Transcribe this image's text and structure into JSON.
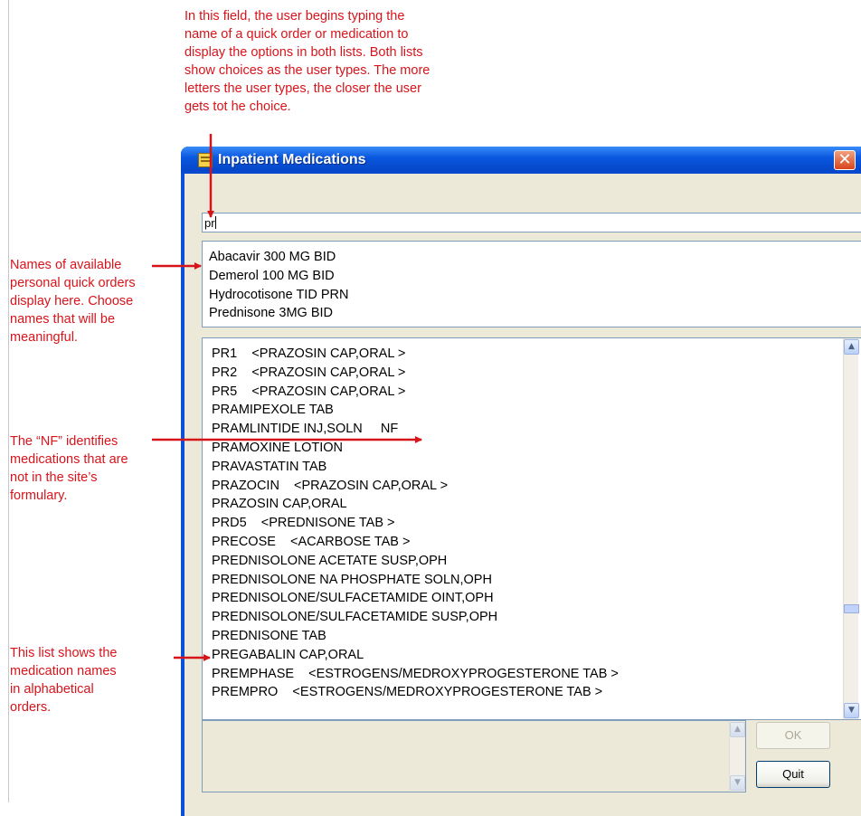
{
  "annotations": {
    "top": [
      "In this field, the user begins typing the",
      "name of a quick order or medication to",
      "display the options in both lists. Both lists",
      "show choices as the user types. The more",
      "letters the user types, the closer the user",
      "gets tot he choice."
    ],
    "quick_orders": [
      "Names of available",
      "personal quick orders",
      "display here. Choose",
      "names that will be",
      "meaningful."
    ],
    "nf": [
      "The “NF” identifies",
      "medications that are",
      "not in the site’s",
      "formulary."
    ],
    "alphabetical": [
      "This list shows the",
      "medication names",
      "in alphabetical",
      "orders."
    ]
  },
  "window": {
    "title": "Inpatient Medications",
    "close_glyph": "✕",
    "search_value": "pr",
    "quick_orders": [
      "Abacavir 300 MG BID",
      "Demerol 100 MG BID",
      "Hydrocotisone TID PRN",
      "Prednisone 3MG BID"
    ],
    "medications": [
      "PR1    <PRAZOSIN CAP,ORAL >",
      "PR2    <PRAZOSIN CAP,ORAL >",
      "PR5    <PRAZOSIN CAP,ORAL >",
      "PRAMIPEXOLE TAB",
      "PRAMLINTIDE INJ,SOLN     NF",
      "PRAMOXINE LOTION",
      "PRAVASTATIN TAB",
      "PRAZOCIN    <PRAZOSIN CAP,ORAL >",
      "PRAZOSIN CAP,ORAL",
      "PRD5    <PREDNISONE TAB >",
      "PRECOSE    <ACARBOSE TAB >",
      "PREDNISOLONE ACETATE SUSP,OPH",
      "PREDNISOLONE NA PHOSPHATE SOLN,OPH",
      "PREDNISOLONE/SULFACETAMIDE OINT,OPH",
      "PREDNISOLONE/SULFACETAMIDE SUSP,OPH",
      "PREDNISONE TAB",
      "PREGABALIN CAP,ORAL",
      "PREMPHASE    <ESTROGENS/MEDROXYPROGESTERONE TAB >",
      "PREMPRO    <ESTROGENS/MEDROXYPROGESTERONE TAB >"
    ],
    "ok_label": "OK",
    "quit_label": "Quit"
  },
  "icons": {
    "title_icon": "form-icon",
    "scroll_up": "▲",
    "scroll_down": "▼"
  },
  "colors": {
    "annotation": "#d8141b",
    "titlebar": "#0a58e0"
  }
}
